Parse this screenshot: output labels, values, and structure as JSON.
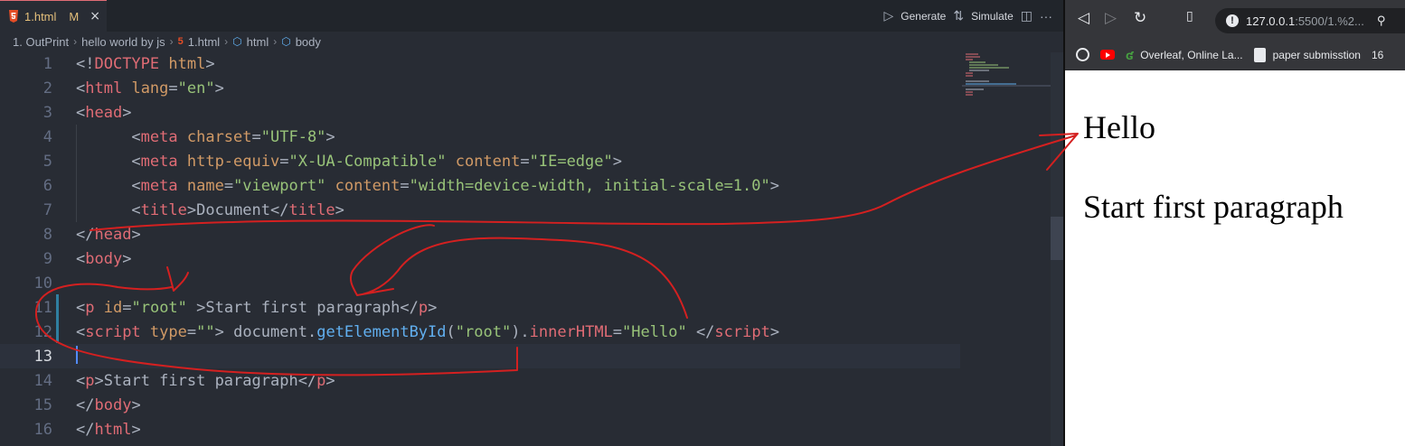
{
  "editor": {
    "tab": {
      "filename": "1.html",
      "modified": "M",
      "close": "×"
    },
    "actions": {
      "generate": "Generate",
      "simulate": "Simulate",
      "more": "···"
    },
    "breadcrumb": [
      "1. OutPrint",
      "hello world by js",
      "1.html",
      "html",
      "body"
    ],
    "current_line": 13,
    "code_lines": [
      {
        "n": "1"
      },
      {
        "n": "2"
      },
      {
        "n": "3"
      },
      {
        "n": "4"
      },
      {
        "n": "5"
      },
      {
        "n": "6"
      },
      {
        "n": "7"
      },
      {
        "n": "8"
      },
      {
        "n": "9"
      },
      {
        "n": "10"
      },
      {
        "n": "11"
      },
      {
        "n": "12"
      },
      {
        "n": "13"
      },
      {
        "n": "14"
      },
      {
        "n": "15"
      },
      {
        "n": "16"
      }
    ],
    "code": {
      "l1": [
        "<!",
        "DOCTYPE",
        " ",
        "html",
        ">"
      ],
      "l2": [
        "<",
        "html",
        " ",
        "lang",
        "=",
        "\"en\"",
        ">"
      ],
      "l3": [
        "<",
        "head",
        ">"
      ],
      "l4": [
        "      <",
        "meta",
        " ",
        "charset",
        "=",
        "\"UTF-8\"",
        ">"
      ],
      "l5": [
        "      <",
        "meta",
        " ",
        "http-equiv",
        "=",
        "\"X-UA-Compatible\"",
        " ",
        "content",
        "=",
        "\"IE=edge\"",
        ">"
      ],
      "l6": [
        "      <",
        "meta",
        " ",
        "name",
        "=",
        "\"viewport\"",
        " ",
        "content",
        "=",
        "\"width=device-width, initial-scale=1.0\"",
        ">"
      ],
      "l7": [
        "      <",
        "title",
        ">",
        "Document",
        "</",
        "title",
        ">"
      ],
      "l8": [
        "</",
        "head",
        ">"
      ],
      "l9": [
        "<",
        "body",
        ">"
      ],
      "l11": [
        "<",
        "p",
        " ",
        "id",
        "=",
        "\"root\"",
        " >",
        "Start first paragraph",
        "</",
        "p",
        ">"
      ],
      "l12": [
        "<",
        "script",
        " ",
        "type",
        "=",
        "\"\"",
        ">",
        " document.",
        "getElementById",
        "(",
        "\"root\"",
        ").",
        "innerHTML",
        "=",
        "\"Hello\"",
        " </",
        "script",
        ">"
      ],
      "l14": [
        "<",
        "p",
        ">",
        "Start first paragraph",
        "</",
        "p",
        ">"
      ],
      "l15": [
        "</",
        "body",
        ">"
      ],
      "l16": [
        "</",
        "html",
        ">"
      ]
    }
  },
  "browser": {
    "address": {
      "host": "127.0.0.1",
      "rest": ":5500/1.%2..."
    },
    "bookmarks": [
      "Overleaf, Online La...",
      "paper submisstion",
      "16"
    ],
    "page": {
      "heading": "Hello",
      "paragraph": "Start first paragraph"
    }
  },
  "colors": {
    "tag": "#e06c75",
    "attr": "#d19a66",
    "string": "#98c379",
    "func": "#61afef",
    "annotation": "#d42020"
  }
}
